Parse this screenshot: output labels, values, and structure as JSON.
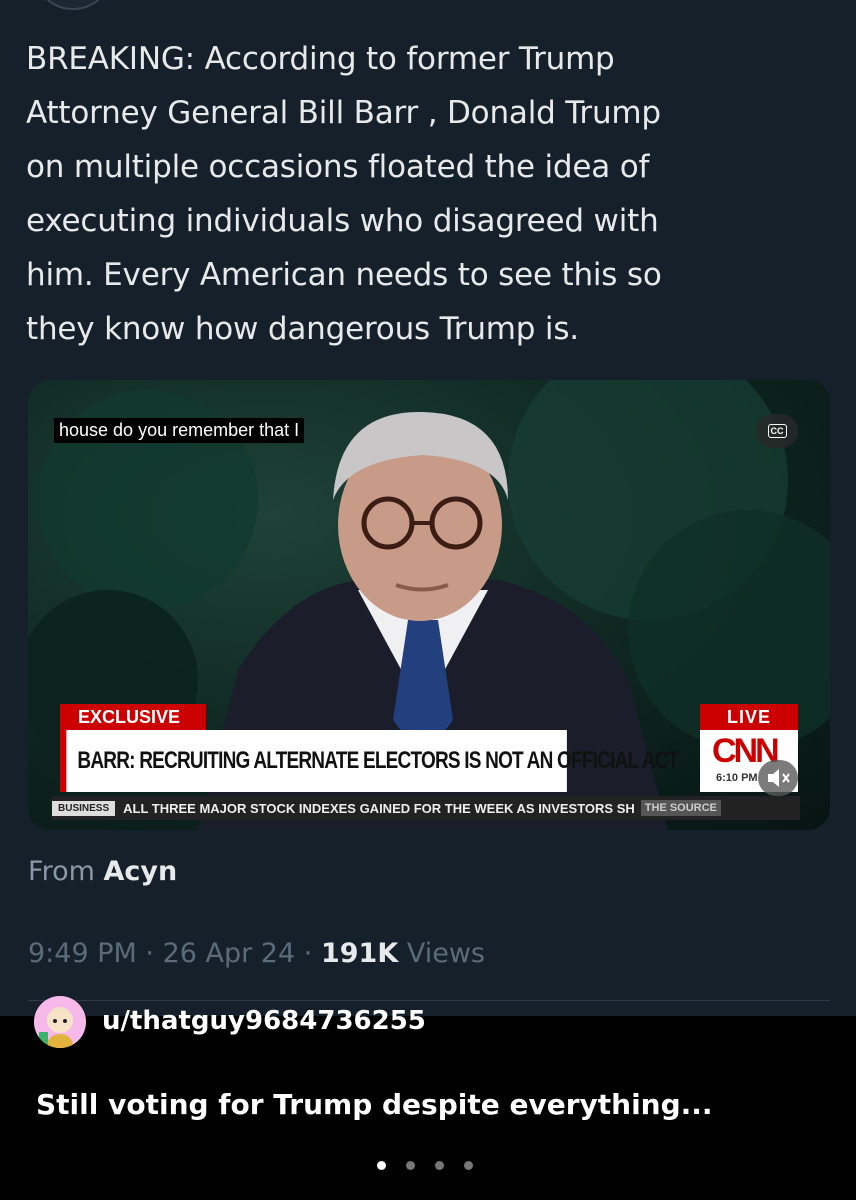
{
  "tweet": {
    "lines": [
      "BREAKING: According to former Trump",
      "Attorney General Bill Barr , Donald Trump",
      "on multiple occasions floated the idea of",
      "executing individuals who disagreed with",
      "him. Every American needs to see this so",
      "they know how dangerous Trump is."
    ],
    "from_prefix": "From",
    "from_account": "Acyn",
    "time": "9:49 PM",
    "date": "26 Apr 24",
    "views_count": "191K",
    "views_label": "Views",
    "separator": "·"
  },
  "video": {
    "caption": "house do you remember that I",
    "cc_label": "CC",
    "exclusive_label": "EXCLUSIVE",
    "live_label": "LIVE",
    "headline": "BARR: RECRUITING ALTERNATE ELECTORS IS NOT AN OFFICIAL ACT",
    "network_logo": "CNN",
    "time_label": "6:10 PM",
    "ticker_tag": "BUSINESS",
    "ticker_text": "ALL THREE MAJOR STOCK INDEXES GAINED FOR THE WEEK AS INVESTORS SH",
    "ticker_source": "THE SOURCE",
    "icons": {
      "cc": "closed-captions-icon",
      "mute": "speaker-muted-icon"
    }
  },
  "post": {
    "username": "u/thatguy9684736255",
    "title": "Still voting for Trump despite everything...",
    "carousel": {
      "total": 4,
      "active": 1
    }
  },
  "colors": {
    "tweet_bg": "#15202b",
    "tweet_text": "#e7e9ea",
    "muted_text": "#8b98a5",
    "cnn_red": "#cc0000"
  }
}
